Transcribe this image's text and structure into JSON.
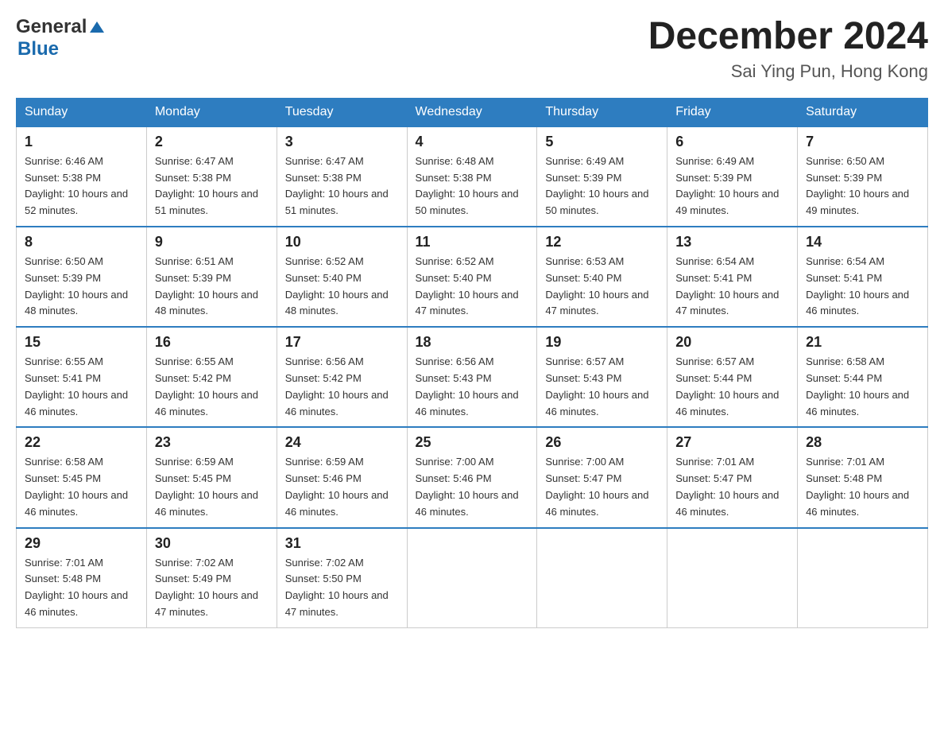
{
  "logo": {
    "general": "General",
    "blue": "Blue"
  },
  "title": "December 2024",
  "location": "Sai Ying Pun, Hong Kong",
  "headers": [
    "Sunday",
    "Monday",
    "Tuesday",
    "Wednesday",
    "Thursday",
    "Friday",
    "Saturday"
  ],
  "weeks": [
    [
      {
        "day": "1",
        "sunrise": "6:46 AM",
        "sunset": "5:38 PM",
        "daylight": "10 hours and 52 minutes."
      },
      {
        "day": "2",
        "sunrise": "6:47 AM",
        "sunset": "5:38 PM",
        "daylight": "10 hours and 51 minutes."
      },
      {
        "day": "3",
        "sunrise": "6:47 AM",
        "sunset": "5:38 PM",
        "daylight": "10 hours and 51 minutes."
      },
      {
        "day": "4",
        "sunrise": "6:48 AM",
        "sunset": "5:38 PM",
        "daylight": "10 hours and 50 minutes."
      },
      {
        "day": "5",
        "sunrise": "6:49 AM",
        "sunset": "5:39 PM",
        "daylight": "10 hours and 50 minutes."
      },
      {
        "day": "6",
        "sunrise": "6:49 AM",
        "sunset": "5:39 PM",
        "daylight": "10 hours and 49 minutes."
      },
      {
        "day": "7",
        "sunrise": "6:50 AM",
        "sunset": "5:39 PM",
        "daylight": "10 hours and 49 minutes."
      }
    ],
    [
      {
        "day": "8",
        "sunrise": "6:50 AM",
        "sunset": "5:39 PM",
        "daylight": "10 hours and 48 minutes."
      },
      {
        "day": "9",
        "sunrise": "6:51 AM",
        "sunset": "5:39 PM",
        "daylight": "10 hours and 48 minutes."
      },
      {
        "day": "10",
        "sunrise": "6:52 AM",
        "sunset": "5:40 PM",
        "daylight": "10 hours and 48 minutes."
      },
      {
        "day": "11",
        "sunrise": "6:52 AM",
        "sunset": "5:40 PM",
        "daylight": "10 hours and 47 minutes."
      },
      {
        "day": "12",
        "sunrise": "6:53 AM",
        "sunset": "5:40 PM",
        "daylight": "10 hours and 47 minutes."
      },
      {
        "day": "13",
        "sunrise": "6:54 AM",
        "sunset": "5:41 PM",
        "daylight": "10 hours and 47 minutes."
      },
      {
        "day": "14",
        "sunrise": "6:54 AM",
        "sunset": "5:41 PM",
        "daylight": "10 hours and 46 minutes."
      }
    ],
    [
      {
        "day": "15",
        "sunrise": "6:55 AM",
        "sunset": "5:41 PM",
        "daylight": "10 hours and 46 minutes."
      },
      {
        "day": "16",
        "sunrise": "6:55 AM",
        "sunset": "5:42 PM",
        "daylight": "10 hours and 46 minutes."
      },
      {
        "day": "17",
        "sunrise": "6:56 AM",
        "sunset": "5:42 PM",
        "daylight": "10 hours and 46 minutes."
      },
      {
        "day": "18",
        "sunrise": "6:56 AM",
        "sunset": "5:43 PM",
        "daylight": "10 hours and 46 minutes."
      },
      {
        "day": "19",
        "sunrise": "6:57 AM",
        "sunset": "5:43 PM",
        "daylight": "10 hours and 46 minutes."
      },
      {
        "day": "20",
        "sunrise": "6:57 AM",
        "sunset": "5:44 PM",
        "daylight": "10 hours and 46 minutes."
      },
      {
        "day": "21",
        "sunrise": "6:58 AM",
        "sunset": "5:44 PM",
        "daylight": "10 hours and 46 minutes."
      }
    ],
    [
      {
        "day": "22",
        "sunrise": "6:58 AM",
        "sunset": "5:45 PM",
        "daylight": "10 hours and 46 minutes."
      },
      {
        "day": "23",
        "sunrise": "6:59 AM",
        "sunset": "5:45 PM",
        "daylight": "10 hours and 46 minutes."
      },
      {
        "day": "24",
        "sunrise": "6:59 AM",
        "sunset": "5:46 PM",
        "daylight": "10 hours and 46 minutes."
      },
      {
        "day": "25",
        "sunrise": "7:00 AM",
        "sunset": "5:46 PM",
        "daylight": "10 hours and 46 minutes."
      },
      {
        "day": "26",
        "sunrise": "7:00 AM",
        "sunset": "5:47 PM",
        "daylight": "10 hours and 46 minutes."
      },
      {
        "day": "27",
        "sunrise": "7:01 AM",
        "sunset": "5:47 PM",
        "daylight": "10 hours and 46 minutes."
      },
      {
        "day": "28",
        "sunrise": "7:01 AM",
        "sunset": "5:48 PM",
        "daylight": "10 hours and 46 minutes."
      }
    ],
    [
      {
        "day": "29",
        "sunrise": "7:01 AM",
        "sunset": "5:48 PM",
        "daylight": "10 hours and 46 minutes."
      },
      {
        "day": "30",
        "sunrise": "7:02 AM",
        "sunset": "5:49 PM",
        "daylight": "10 hours and 47 minutes."
      },
      {
        "day": "31",
        "sunrise": "7:02 AM",
        "sunset": "5:50 PM",
        "daylight": "10 hours and 47 minutes."
      },
      null,
      null,
      null,
      null
    ]
  ]
}
